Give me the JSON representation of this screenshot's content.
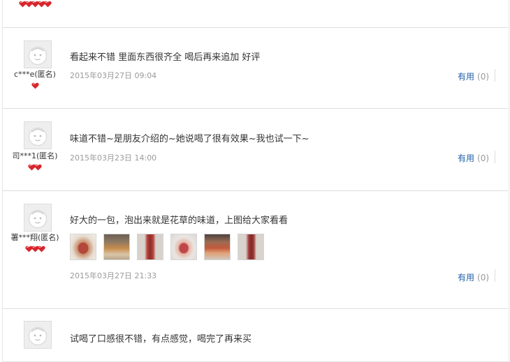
{
  "icons": {
    "avatar": "default-avatar-icon",
    "level_heart": "red-heart-icon"
  },
  "colors": {
    "heart": "#d7262c",
    "useful_link": "#1f5fa8",
    "date_text": "#9a9a9a"
  },
  "top_partial": {
    "level_hearts": 5
  },
  "reviews": [
    {
      "username": "c***e(匿名)",
      "level_hearts": 1,
      "content": "看起来不错 里面东西很齐全 喝后再来追加 好评",
      "date": "2015年03月27日 09:04",
      "useful_label": "有用",
      "useful_count": "(0)"
    },
    {
      "username": "司***1(匿名)",
      "level_hearts": 2,
      "content": "味道不错~是朋友介绍的~她说喝了很有效果~我也试一下~",
      "date": "2015年03月23日 14:00",
      "useful_label": "有用",
      "useful_count": "(0)"
    },
    {
      "username": "署***翔(匿名)",
      "level_hearts": 3,
      "content": "好大的一包，泡出来就是花草的味道，上图给大家看看",
      "photo_count": 6,
      "date": "2015年03月27日 21:33",
      "useful_label": "有用",
      "useful_count": "(0)"
    },
    {
      "content": "试喝了口感很不错，有点感觉，喝完了再来买"
    }
  ]
}
